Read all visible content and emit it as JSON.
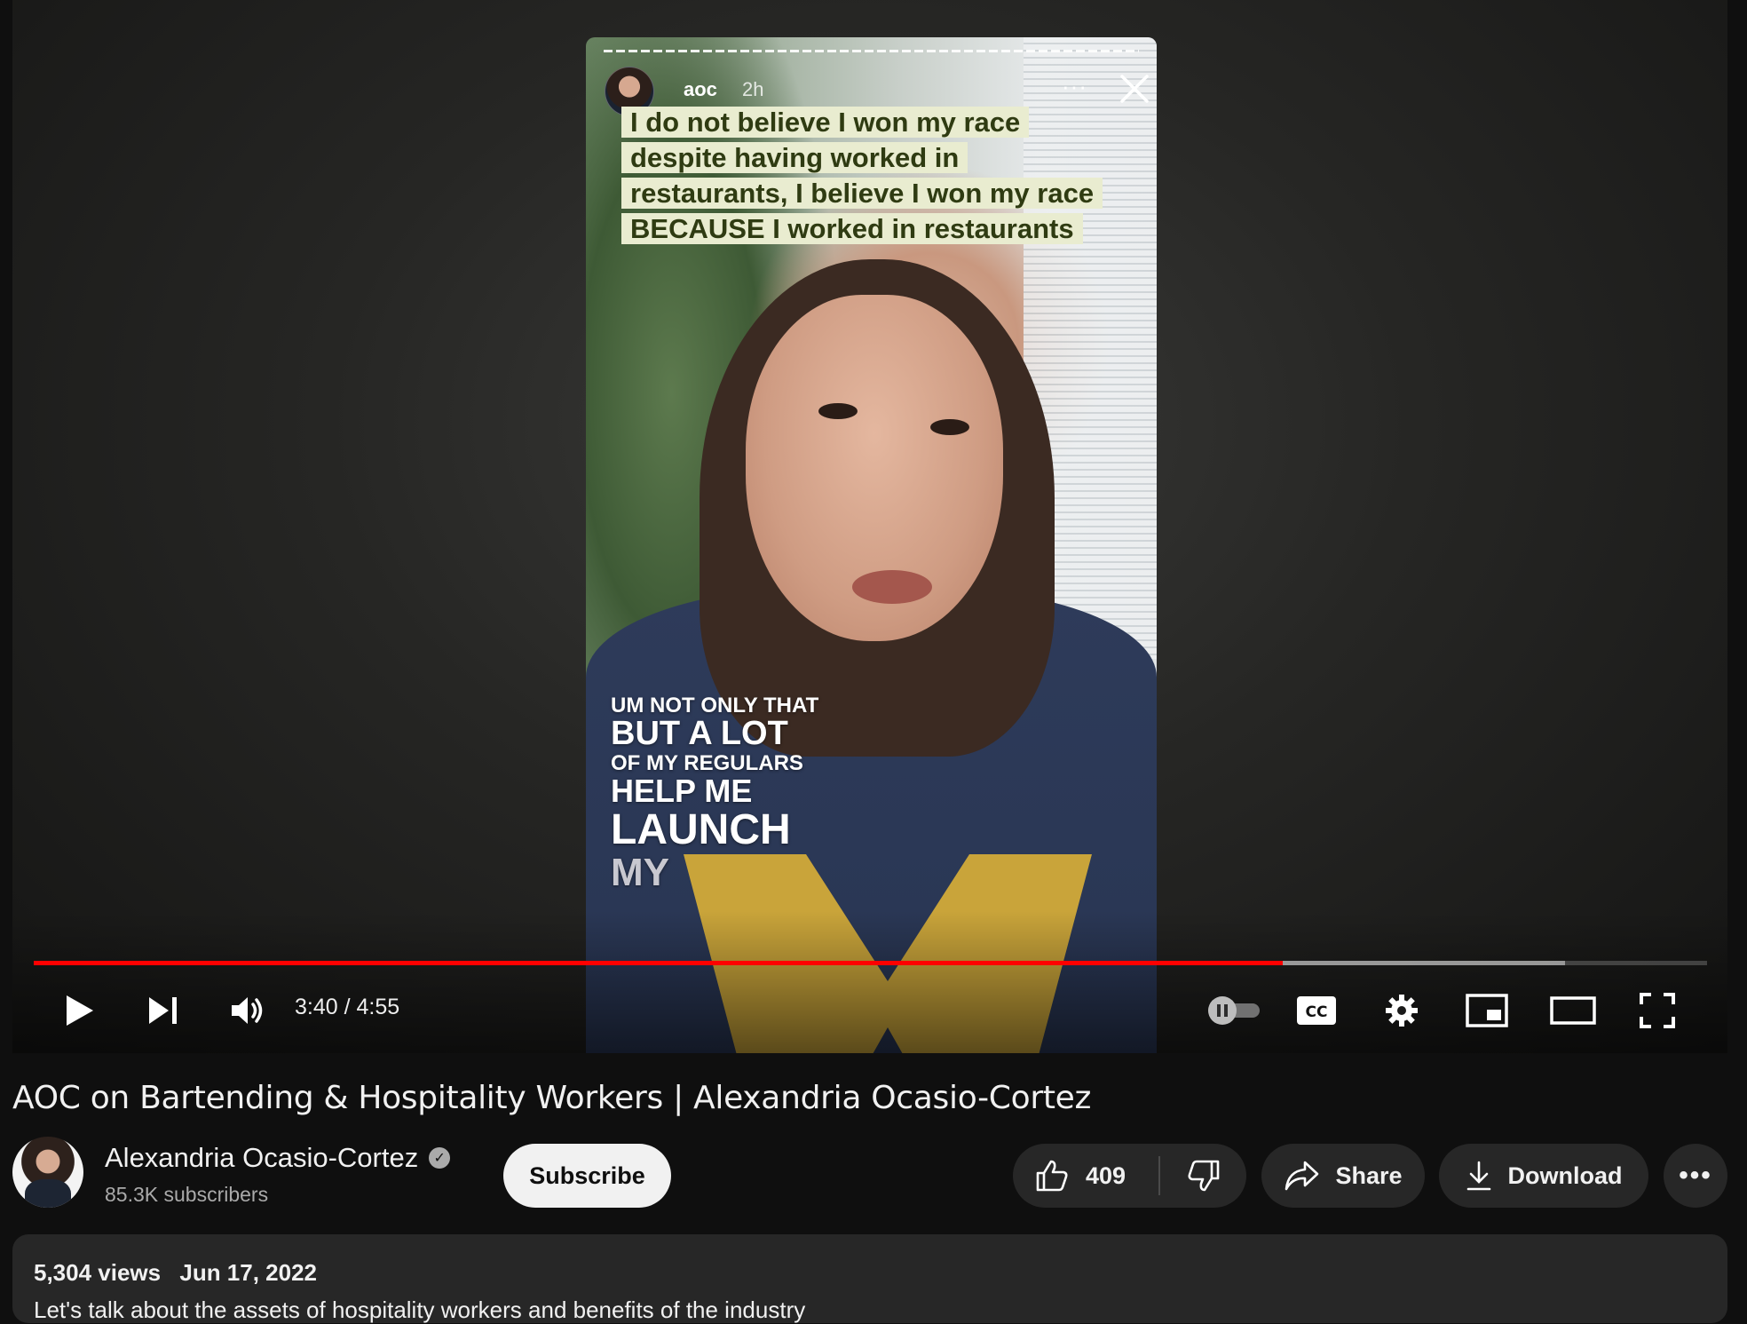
{
  "story": {
    "username": "aoc",
    "time_ago": "2h",
    "more_label": "···",
    "caption_lines": [
      "I do not believe I won my race",
      "despite having worked in",
      "restaurants, I believe I won my race",
      "BECAUSE I worked in restaurants"
    ],
    "subtitle_lines": [
      "UM NOT ONLY THAT",
      "BUT A LOT",
      "OF MY REGULARS",
      "HELP ME",
      "LAUNCH",
      "MY"
    ]
  },
  "player": {
    "time": "3:40 / 4:55",
    "played_fraction": 0.7466,
    "buffered_fraction": 0.915,
    "played_color": "#ff0000"
  },
  "video": {
    "title": "AOC on Bartending & Hospitality Workers | Alexandria Ocasio-Cortez"
  },
  "channel": {
    "name": "Alexandria Ocasio-Cortez",
    "subscribers": "85.3K subscribers",
    "subscribe_label": "Subscribe"
  },
  "actions": {
    "like_count": "409",
    "share_label": "Share",
    "download_label": "Download"
  },
  "description": {
    "views": "5,304 views",
    "date": "Jun 17, 2022",
    "snippet": "Let's talk about the assets of hospitality workers and benefits of the industry"
  }
}
